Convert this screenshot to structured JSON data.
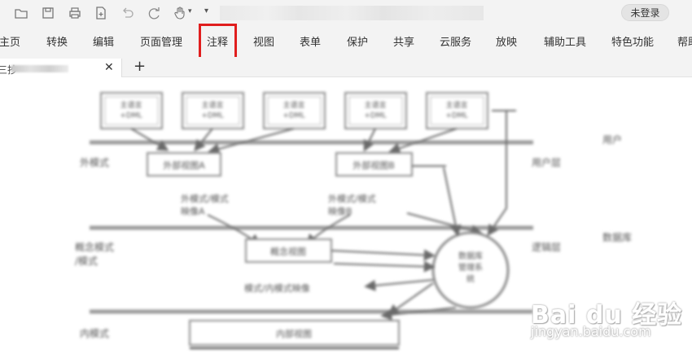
{
  "quick_toolbar": {
    "icons": [
      "open-folder-icon",
      "save-icon",
      "print-icon",
      "new-document-icon",
      "undo-icon",
      "redo-icon",
      "hand-tool-icon"
    ],
    "dropdown_glyph": "▾",
    "login_label": "未登录"
  },
  "menu": {
    "items": [
      "主页",
      "转换",
      "编辑",
      "页面管理",
      "注释",
      "视图",
      "表单",
      "保护",
      "共享",
      "云服务",
      "放映",
      "辅助工具",
      "特色功能",
      "帮助"
    ],
    "highlighted": "注释",
    "highlight_color": "#e01e1e"
  },
  "tabs": {
    "doc_tab_title": "三抄",
    "close_glyph": "✕",
    "new_tab_glyph": "+"
  },
  "diagram": {
    "top_boxes": [
      "主语言\n+DML",
      "主语言\n+DML",
      "主语言\n+DML",
      "主语言\n+DML",
      "主语言\n+DML"
    ],
    "external_views": [
      "外部视图A",
      "外部视图B"
    ],
    "mappings": [
      "外模式/模式\n映像A",
      "外模式/模式\n映像B"
    ],
    "concept_view": "概念视图",
    "schema_mapping": "模式/内模式映像",
    "dbms": "数据库\n管理系\n统",
    "internal_view": "内部视图",
    "left_labels": [
      "外模式",
      "概念模式\n/模式",
      "内模式"
    ],
    "right_labels": [
      "用户",
      "用户层",
      "数据库",
      "逻辑层"
    ]
  },
  "watermark": {
    "brand": "Bai du 经验",
    "site": "jingyan.baidu.com"
  }
}
